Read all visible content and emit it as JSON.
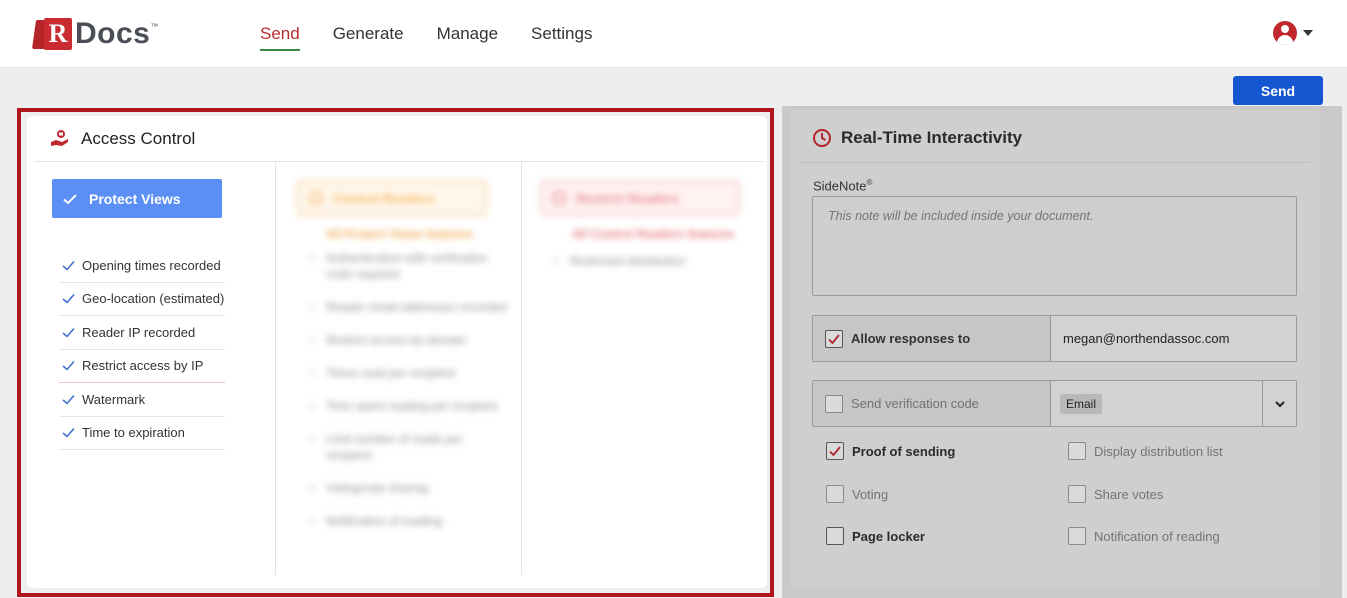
{
  "brand": {
    "logo_letter": "R",
    "logo_text": "Docs",
    "trademark": "™"
  },
  "nav": {
    "items": [
      {
        "label": "Send",
        "active": true
      },
      {
        "label": "Generate",
        "active": false
      },
      {
        "label": "Manage",
        "active": false
      },
      {
        "label": "Settings",
        "active": false
      }
    ]
  },
  "header": {
    "send_label": "Send",
    "user_icon": "user-circle-icon"
  },
  "access_control": {
    "title": "Access Control",
    "protect_views": {
      "label": "Protect Views",
      "features": [
        "Opening times recorded",
        "Geo-location (estimated)",
        "Reader IP recorded",
        "Restrict access by IP",
        "Watermark",
        "Time to expiration"
      ]
    },
    "control_readers": {
      "label": "Control Readers",
      "subtitle": "All Protect Views features",
      "features": [
        "Authentication with verification code required",
        "Reader email addresses recorded",
        "Restrict access by domain",
        "Times read per recipient",
        "Time spent reading per recipient",
        "Limit number of reads per recipient",
        "Voting/vote sharing",
        "Notification of reading"
      ]
    },
    "restrict_readers": {
      "label": "Restrict Readers",
      "subtitle": "All Control Readers features",
      "features": [
        "Restricted distribution"
      ]
    }
  },
  "real_time": {
    "title": "Real-Time Interactivity",
    "sidenote_label": "SideNote",
    "sidenote_mark": "®",
    "sidenote_placeholder": "This note will be included inside your document.",
    "allow_responses": {
      "label": "Allow responses to",
      "checked": true,
      "value": "megan@northendassoc.com"
    },
    "verification": {
      "label": "Send verification code",
      "checked": false,
      "method": "Email"
    },
    "options": [
      {
        "label": "Proof of sending",
        "checked": true,
        "enabled": true
      },
      {
        "label": "Display distribution list",
        "checked": false,
        "enabled": false
      },
      {
        "label": "Voting",
        "checked": false,
        "enabled": false
      },
      {
        "label": "Share votes",
        "checked": false,
        "enabled": false
      },
      {
        "label": "Page locker",
        "checked": false,
        "enabled": true
      },
      {
        "label": "Notification of reading",
        "checked": false,
        "enabled": false
      }
    ]
  },
  "colors": {
    "brand_red": "#c92b31",
    "send_blue": "#1557d1",
    "protect_blue": "#5b8ff5",
    "highlight_red": "#b0151c",
    "nav_underline": "#3a8a46"
  }
}
